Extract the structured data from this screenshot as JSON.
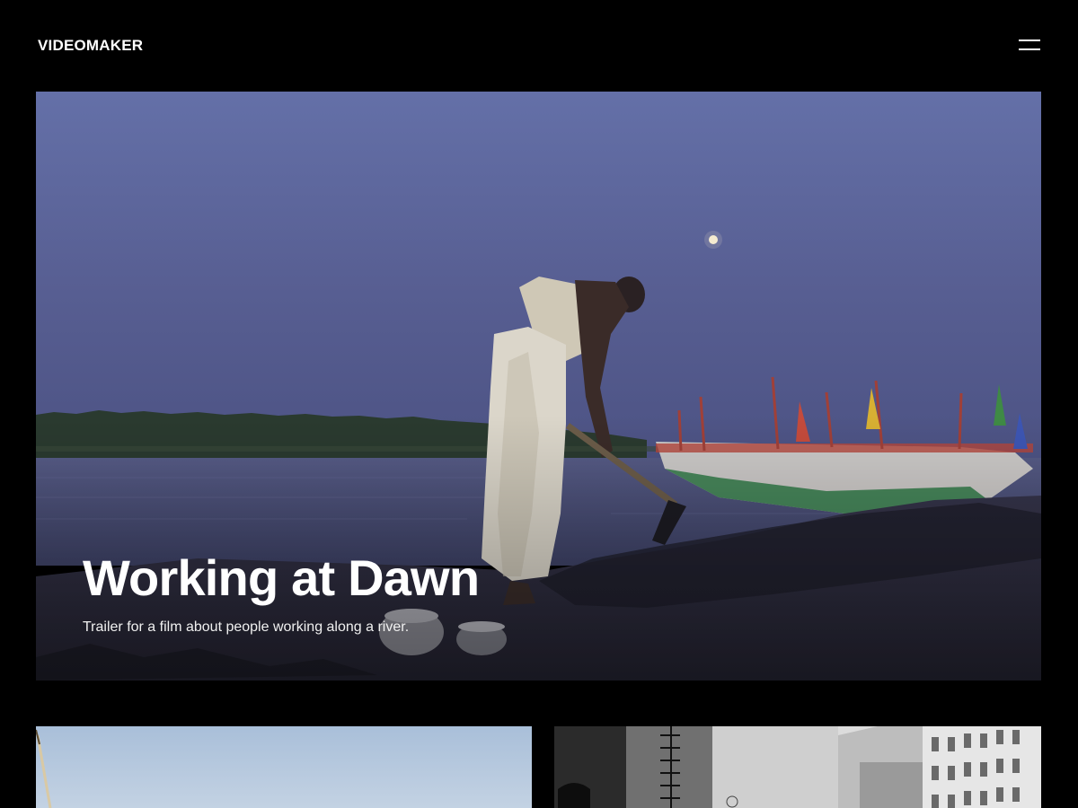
{
  "header": {
    "logo": "VIDEOMAKER",
    "menu_icon": "hamburger-menu-icon"
  },
  "hero": {
    "title": "Working at Dawn",
    "subtitle": "Trailer for a film about people working along a river."
  },
  "colors": {
    "background": "#000000",
    "text": "#ffffff",
    "sky_top": "#5f6aa3",
    "sky_bottom": "#4f5585",
    "water": "#4a4f78",
    "sand": "#2f2e40"
  }
}
